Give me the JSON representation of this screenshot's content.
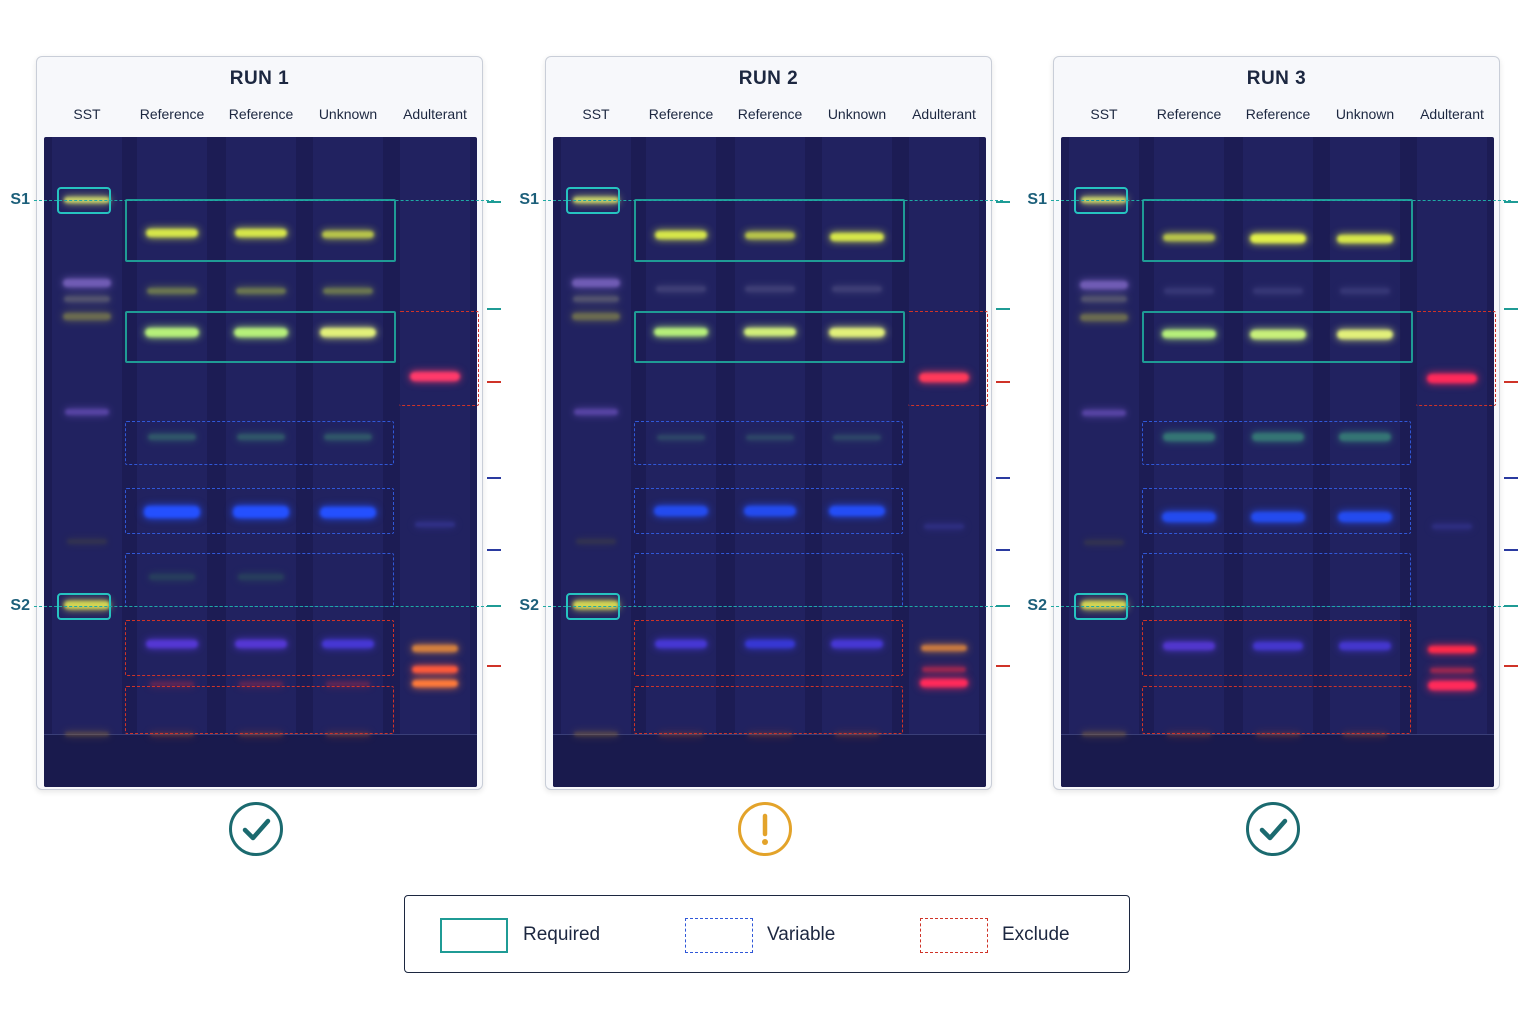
{
  "lane_labels": [
    "SST",
    "Reference",
    "Reference",
    "Unknown",
    "Adulterant"
  ],
  "runs": [
    {
      "title": "RUN 1",
      "status": "pass",
      "status_icon": "check-circle-icon",
      "status_color": "#1b6a6f"
    },
    {
      "title": "RUN 2",
      "status": "warning",
      "status_icon": "exclamation-circle-icon",
      "status_color": "#e3a32a"
    },
    {
      "title": "RUN 3",
      "status": "pass",
      "status_icon": "check-circle-icon",
      "status_color": "#1b6a6f"
    }
  ],
  "markers": {
    "s1": "S1",
    "s2": "S2"
  },
  "legend": {
    "required": "Required",
    "variable": "Variable",
    "exclude": "Exclude"
  },
  "colors": {
    "required": "#1f9b95",
    "variable": "#3058d8",
    "exclude": "#cf3328",
    "plate": "#1c1c54"
  }
}
